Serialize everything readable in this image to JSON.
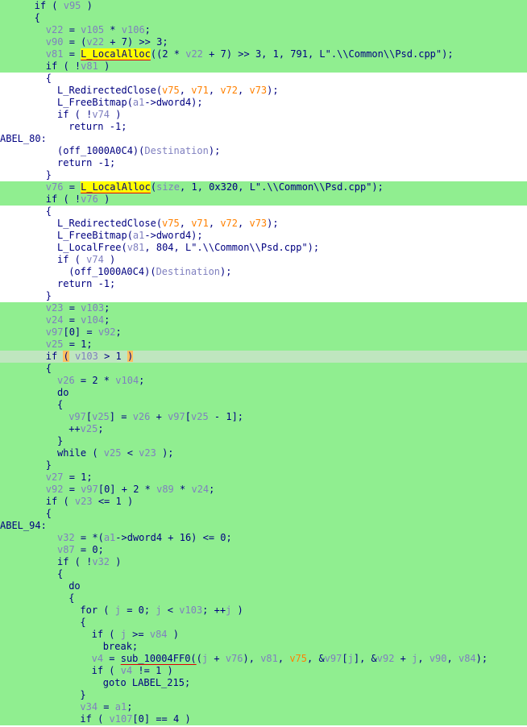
{
  "lines": [
    {
      "bg": "green",
      "indent": 6,
      "tokens": [
        {
          "t": "if ( "
        },
        {
          "t": "v95",
          "c": "var"
        },
        {
          "t": " )"
        }
      ]
    },
    {
      "bg": "green",
      "indent": 6,
      "tokens": [
        {
          "t": "{"
        }
      ]
    },
    {
      "bg": "green",
      "indent": 8,
      "tokens": [
        {
          "t": "v22",
          "c": "var"
        },
        {
          "t": " = "
        },
        {
          "t": "v105",
          "c": "var"
        },
        {
          "t": " * "
        },
        {
          "t": "v106",
          "c": "var"
        },
        {
          "t": ";"
        }
      ]
    },
    {
      "bg": "green",
      "indent": 8,
      "tokens": [
        {
          "t": "v90",
          "c": "var"
        },
        {
          "t": " = ("
        },
        {
          "t": "v22",
          "c": "var"
        },
        {
          "t": " + 7) >> 3;"
        }
      ]
    },
    {
      "bg": "green",
      "indent": 8,
      "tokens": [
        {
          "t": "v81",
          "c": "var"
        },
        {
          "t": " = "
        },
        {
          "t": "L_LocalAlloc",
          "c": "hl-und"
        },
        {
          "t": "((2 * "
        },
        {
          "t": "v22",
          "c": "var"
        },
        {
          "t": " + 7) >> 3, 1, 791, L\".\\\\Common\\\\Psd.cpp\");"
        }
      ]
    },
    {
      "bg": "green",
      "indent": 8,
      "tokens": [
        {
          "t": "if ( !"
        },
        {
          "t": "v81",
          "c": "var"
        },
        {
          "t": " )"
        }
      ]
    },
    {
      "bg": "white",
      "indent": 8,
      "tokens": [
        {
          "t": "{"
        }
      ]
    },
    {
      "bg": "white",
      "indent": 10,
      "tokens": [
        {
          "t": "L_RedirectedClose("
        },
        {
          "t": "v75",
          "c": "arg"
        },
        {
          "t": ", "
        },
        {
          "t": "v71",
          "c": "arg"
        },
        {
          "t": ", "
        },
        {
          "t": "v72",
          "c": "arg"
        },
        {
          "t": ", "
        },
        {
          "t": "v73",
          "c": "arg"
        },
        {
          "t": ");"
        }
      ]
    },
    {
      "bg": "white",
      "indent": 10,
      "tokens": [
        {
          "t": "L_FreeBitmap("
        },
        {
          "t": "a1",
          "c": "var"
        },
        {
          "t": "->dword4);"
        }
      ]
    },
    {
      "bg": "white",
      "indent": 10,
      "tokens": [
        {
          "t": "if ( !"
        },
        {
          "t": "v74",
          "c": "var"
        },
        {
          "t": " )"
        }
      ]
    },
    {
      "bg": "white",
      "indent": 12,
      "tokens": [
        {
          "t": "return -1;"
        }
      ]
    },
    {
      "bg": "white",
      "indent": 0,
      "tokens": [
        {
          "t": "ABEL_80:"
        }
      ]
    },
    {
      "bg": "white",
      "indent": 10,
      "tokens": [
        {
          "t": "(off_1000A0C4)("
        },
        {
          "t": "Destination",
          "c": "var"
        },
        {
          "t": ");"
        }
      ]
    },
    {
      "bg": "white",
      "indent": 10,
      "tokens": [
        {
          "t": "return -1;"
        }
      ]
    },
    {
      "bg": "white",
      "indent": 8,
      "tokens": [
        {
          "t": "}"
        }
      ]
    },
    {
      "bg": "green",
      "indent": 8,
      "tokens": [
        {
          "t": "v76",
          "c": "var"
        },
        {
          "t": " = "
        },
        {
          "t": "L_LocalAlloc",
          "c": "hl-und"
        },
        {
          "t": "("
        },
        {
          "t": "size",
          "c": "var"
        },
        {
          "t": ", 1, 0x320, L\".\\\\Common\\\\Psd.cpp\");"
        }
      ]
    },
    {
      "bg": "green",
      "indent": 8,
      "tokens": [
        {
          "t": "if ( !"
        },
        {
          "t": "v76",
          "c": "var"
        },
        {
          "t": " )"
        }
      ]
    },
    {
      "bg": "white",
      "indent": 8,
      "tokens": [
        {
          "t": "{"
        }
      ]
    },
    {
      "bg": "white",
      "indent": 10,
      "tokens": [
        {
          "t": "L_RedirectedClose("
        },
        {
          "t": "v75",
          "c": "arg"
        },
        {
          "t": ", "
        },
        {
          "t": "v71",
          "c": "arg"
        },
        {
          "t": ", "
        },
        {
          "t": "v72",
          "c": "arg"
        },
        {
          "t": ", "
        },
        {
          "t": "v73",
          "c": "arg"
        },
        {
          "t": ");"
        }
      ]
    },
    {
      "bg": "white",
      "indent": 10,
      "tokens": [
        {
          "t": "L_FreeBitmap("
        },
        {
          "t": "a1",
          "c": "var"
        },
        {
          "t": "->dword4);"
        }
      ]
    },
    {
      "bg": "white",
      "indent": 10,
      "tokens": [
        {
          "t": "L_LocalFree("
        },
        {
          "t": "v81",
          "c": "var"
        },
        {
          "t": ", 804, L\".\\\\Common\\\\Psd.cpp\");"
        }
      ]
    },
    {
      "bg": "white",
      "indent": 10,
      "tokens": [
        {
          "t": "if ( "
        },
        {
          "t": "v74",
          "c": "var"
        },
        {
          "t": " )"
        }
      ]
    },
    {
      "bg": "white",
      "indent": 12,
      "tokens": [
        {
          "t": "(off_1000A0C4)("
        },
        {
          "t": "Destination",
          "c": "var"
        },
        {
          "t": ");"
        }
      ]
    },
    {
      "bg": "white",
      "indent": 10,
      "tokens": [
        {
          "t": "return -1;"
        }
      ]
    },
    {
      "bg": "white",
      "indent": 8,
      "tokens": [
        {
          "t": "}"
        }
      ]
    },
    {
      "bg": "green",
      "indent": 8,
      "tokens": [
        {
          "t": "v23",
          "c": "var"
        },
        {
          "t": " = "
        },
        {
          "t": "v103",
          "c": "var"
        },
        {
          "t": ";"
        }
      ]
    },
    {
      "bg": "green",
      "indent": 8,
      "tokens": [
        {
          "t": "v24",
          "c": "var"
        },
        {
          "t": " = "
        },
        {
          "t": "v104",
          "c": "var"
        },
        {
          "t": ";"
        }
      ]
    },
    {
      "bg": "green",
      "indent": 8,
      "tokens": [
        {
          "t": "v97",
          "c": "var"
        },
        {
          "t": "[0] = "
        },
        {
          "t": "v92",
          "c": "var"
        },
        {
          "t": ";"
        }
      ]
    },
    {
      "bg": "green",
      "indent": 8,
      "tokens": [
        {
          "t": "v25",
          "c": "var"
        },
        {
          "t": " = 1;"
        }
      ]
    },
    {
      "bg": "gray",
      "indent": 8,
      "tokens": [
        {
          "t": "if "
        },
        {
          "t": "(",
          "c": "hlo"
        },
        {
          "t": " "
        },
        {
          "t": "v103",
          "c": "var"
        },
        {
          "t": " > 1 "
        },
        {
          "t": ")",
          "c": "hlo"
        }
      ]
    },
    {
      "bg": "green",
      "indent": 8,
      "tokens": [
        {
          "t": "{"
        }
      ]
    },
    {
      "bg": "green",
      "indent": 10,
      "tokens": [
        {
          "t": "v26",
          "c": "var"
        },
        {
          "t": " = 2 * "
        },
        {
          "t": "v104",
          "c": "var"
        },
        {
          "t": ";"
        }
      ]
    },
    {
      "bg": "green",
      "indent": 10,
      "tokens": [
        {
          "t": "do"
        }
      ]
    },
    {
      "bg": "green",
      "indent": 10,
      "tokens": [
        {
          "t": "{"
        }
      ]
    },
    {
      "bg": "green",
      "indent": 12,
      "tokens": [
        {
          "t": "v97",
          "c": "var"
        },
        {
          "t": "["
        },
        {
          "t": "v25",
          "c": "var"
        },
        {
          "t": "] = "
        },
        {
          "t": "v26",
          "c": "var"
        },
        {
          "t": " + "
        },
        {
          "t": "v97",
          "c": "var"
        },
        {
          "t": "["
        },
        {
          "t": "v25",
          "c": "var"
        },
        {
          "t": " - 1];"
        }
      ]
    },
    {
      "bg": "green",
      "indent": 12,
      "tokens": [
        {
          "t": "++"
        },
        {
          "t": "v25",
          "c": "var"
        },
        {
          "t": ";"
        }
      ]
    },
    {
      "bg": "green",
      "indent": 10,
      "tokens": [
        {
          "t": "}"
        }
      ]
    },
    {
      "bg": "green",
      "indent": 10,
      "tokens": [
        {
          "t": "while ( "
        },
        {
          "t": "v25",
          "c": "var"
        },
        {
          "t": " < "
        },
        {
          "t": "v23",
          "c": "var"
        },
        {
          "t": " );"
        }
      ]
    },
    {
      "bg": "green",
      "indent": 8,
      "tokens": [
        {
          "t": "}"
        }
      ]
    },
    {
      "bg": "green",
      "indent": 8,
      "tokens": [
        {
          "t": "v27",
          "c": "var"
        },
        {
          "t": " = 1;"
        }
      ]
    },
    {
      "bg": "green",
      "indent": 8,
      "tokens": [
        {
          "t": "v92",
          "c": "var"
        },
        {
          "t": " = "
        },
        {
          "t": "v97",
          "c": "var"
        },
        {
          "t": "[0] + 2 * "
        },
        {
          "t": "v89",
          "c": "var"
        },
        {
          "t": " * "
        },
        {
          "t": "v24",
          "c": "var"
        },
        {
          "t": ";"
        }
      ]
    },
    {
      "bg": "green",
      "indent": 8,
      "tokens": [
        {
          "t": "if ( "
        },
        {
          "t": "v23",
          "c": "var"
        },
        {
          "t": " <= 1 )"
        }
      ]
    },
    {
      "bg": "green",
      "indent": 8,
      "tokens": [
        {
          "t": "{"
        }
      ]
    },
    {
      "bg": "green",
      "indent": 0,
      "tokens": [
        {
          "t": "ABEL_94:"
        }
      ]
    },
    {
      "bg": "green",
      "indent": 10,
      "tokens": [
        {
          "t": "v32",
          "c": "var"
        },
        {
          "t": " = *("
        },
        {
          "t": "a1",
          "c": "var"
        },
        {
          "t": "->dword4 + 16) <= 0;"
        }
      ]
    },
    {
      "bg": "green",
      "indent": 10,
      "tokens": [
        {
          "t": "v87",
          "c": "var"
        },
        {
          "t": " = 0;"
        }
      ]
    },
    {
      "bg": "green",
      "indent": 10,
      "tokens": [
        {
          "t": "if ( !"
        },
        {
          "t": "v32",
          "c": "var"
        },
        {
          "t": " )"
        }
      ]
    },
    {
      "bg": "green",
      "indent": 10,
      "tokens": [
        {
          "t": "{"
        }
      ]
    },
    {
      "bg": "green",
      "indent": 12,
      "tokens": [
        {
          "t": "do"
        }
      ]
    },
    {
      "bg": "green",
      "indent": 12,
      "tokens": [
        {
          "t": "{"
        }
      ]
    },
    {
      "bg": "green",
      "indent": 14,
      "tokens": [
        {
          "t": "for ( "
        },
        {
          "t": "j",
          "c": "var"
        },
        {
          "t": " = 0; "
        },
        {
          "t": "j",
          "c": "var"
        },
        {
          "t": " < "
        },
        {
          "t": "v103",
          "c": "var"
        },
        {
          "t": "; ++"
        },
        {
          "t": "j",
          "c": "var"
        },
        {
          "t": " )"
        }
      ]
    },
    {
      "bg": "green",
      "indent": 14,
      "tokens": [
        {
          "t": "{"
        }
      ]
    },
    {
      "bg": "green",
      "indent": 16,
      "tokens": [
        {
          "t": "if ( "
        },
        {
          "t": "j",
          "c": "var"
        },
        {
          "t": " >= "
        },
        {
          "t": "v84",
          "c": "var"
        },
        {
          "t": " )"
        }
      ]
    },
    {
      "bg": "green",
      "indent": 18,
      "tokens": [
        {
          "t": "break;"
        }
      ]
    },
    {
      "bg": "green",
      "indent": 16,
      "tokens": [
        {
          "t": "v4",
          "c": "var"
        },
        {
          "t": " = "
        },
        {
          "t": "sub_10004FF0(",
          "c": "und"
        },
        {
          "t": "("
        },
        {
          "t": "j",
          "c": "var"
        },
        {
          "t": " + "
        },
        {
          "t": "v76",
          "c": "var"
        },
        {
          "t": "), "
        },
        {
          "t": "v81",
          "c": "var"
        },
        {
          "t": ", "
        },
        {
          "t": "v75",
          "c": "arg"
        },
        {
          "t": ", &"
        },
        {
          "t": "v97",
          "c": "var"
        },
        {
          "t": "["
        },
        {
          "t": "j",
          "c": "var"
        },
        {
          "t": "], &"
        },
        {
          "t": "v92",
          "c": "var"
        },
        {
          "t": " + "
        },
        {
          "t": "j",
          "c": "var"
        },
        {
          "t": ", "
        },
        {
          "t": "v90",
          "c": "var"
        },
        {
          "t": ", "
        },
        {
          "t": "v84",
          "c": "var"
        },
        {
          "t": ");"
        }
      ]
    },
    {
      "bg": "green",
      "indent": 16,
      "tokens": [
        {
          "t": "if ( "
        },
        {
          "t": "v4",
          "c": "var"
        },
        {
          "t": " != 1 )"
        }
      ]
    },
    {
      "bg": "green",
      "indent": 18,
      "tokens": [
        {
          "t": "goto LABEL_215;"
        }
      ]
    },
    {
      "bg": "green",
      "indent": 14,
      "tokens": [
        {
          "t": "}"
        }
      ]
    },
    {
      "bg": "green",
      "indent": 14,
      "tokens": [
        {
          "t": "v34",
          "c": "var"
        },
        {
          "t": " = "
        },
        {
          "t": "a1",
          "c": "var"
        },
        {
          "t": ";"
        }
      ]
    },
    {
      "bg": "green",
      "indent": 14,
      "tokens": [
        {
          "t": "if ( "
        },
        {
          "t": "v107",
          "c": "var"
        },
        {
          "t": "[0] == 4 )"
        }
      ]
    }
  ]
}
